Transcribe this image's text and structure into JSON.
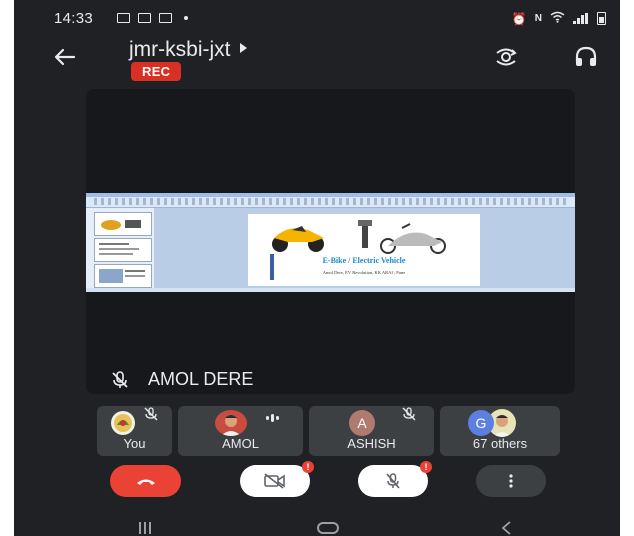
{
  "status_bar": {
    "time": "14:33"
  },
  "header": {
    "meeting_code": "jmr-ksbi-jxt",
    "rec_label": "REC",
    "icons": [
      "back-arrow-icon",
      "switch-camera-icon",
      "headphones-icon"
    ]
  },
  "main_tile": {
    "speaker_name": "AMOL DERE",
    "shared_slide": {
      "title": "E-Bike / Electric Vehicle",
      "subtitle": "Amol Dere, EV Revolution, KK ARAI , Pune"
    }
  },
  "participants": [
    {
      "label": "You",
      "muted": true
    },
    {
      "label": "AMOL",
      "speaking": true
    },
    {
      "label": "ASHISH",
      "initial": "A",
      "muted": true
    },
    {
      "label": "67 others",
      "initial": "G"
    }
  ],
  "colors": {
    "background": "#202124",
    "tile": "#3c4043",
    "end_call": "#ea4335",
    "rec": "#d93025",
    "avatar_a": "#b07a6f",
    "avatar_g": "#5c7fe0"
  },
  "controls": [
    "end-call-button",
    "camera-off-button",
    "mic-off-button",
    "more-options-button"
  ]
}
